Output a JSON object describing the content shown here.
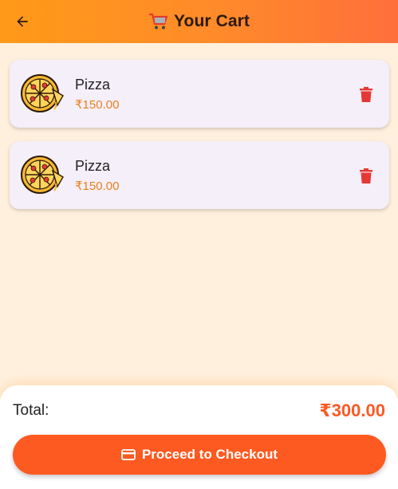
{
  "appbar": {
    "title": "Your Cart",
    "back_icon": "arrow-left-icon",
    "title_icon": "shopping-cart-icon",
    "gradient_start": "#ff9a18",
    "gradient_end": "#ff6f3c"
  },
  "cart": {
    "items": [
      {
        "name": "Pizza",
        "price": "₹150.00",
        "image": "pizza-icon",
        "delete_icon": "trash-icon"
      },
      {
        "name": "Pizza",
        "price": "₹150.00",
        "image": "pizza-icon",
        "delete_icon": "trash-icon"
      }
    ]
  },
  "summary": {
    "total_label": "Total:",
    "total_value": "₹300.00",
    "checkout_label": "Proceed to Checkout",
    "checkout_icon": "credit-card-icon",
    "accent_color": "#fd5a22"
  },
  "colors": {
    "background": "#fff0dd",
    "card_background": "#f4eff8",
    "price_color": "#e8801e",
    "delete_color": "#e53935"
  }
}
